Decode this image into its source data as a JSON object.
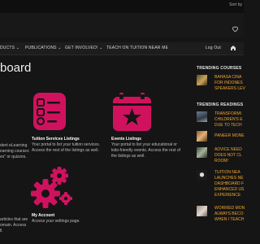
{
  "topbar": {
    "sort_label": "Sort by"
  },
  "nav": {
    "items": [
      "DUCTS ⌄",
      "PUBLICATIONS ⌄",
      "GET INVOLVED! ⌄",
      "TEACH ON TUITION NEAR ME"
    ],
    "logout": "Log Out"
  },
  "page": {
    "title": "board"
  },
  "left_partial": {
    "lines1": [
      "dent eLearning",
      "earning courses",
      "es\" or quizzes."
    ],
    "lines2": [
      "articles that are",
      "omain. Access",
      "ll."
    ]
  },
  "cards": [
    {
      "title": "Tuition Services Listings",
      "desc": [
        "Your portal to list your tuition services.",
        "Access the rest of the listings as well."
      ],
      "icon": "list-checklist-icon"
    },
    {
      "title": "Events Listings",
      "desc": [
        "Your portal to list your educational or",
        "kids-friendly events. Access the rest of",
        "the listings as well."
      ],
      "icon": "calendar-star-icon"
    },
    {
      "title": "My Account",
      "desc": [
        "Access your settings page."
      ],
      "icon": "gears-icon"
    }
  ],
  "sidebar": {
    "trending_courses_heading": "TRENDING COURSES",
    "courses": [
      {
        "lines": [
          "BAHASA CINA",
          "FOR INDONES",
          "SPEAKERS LEV"
        ]
      }
    ],
    "trending_readings_heading": "TRENDING READINGS",
    "readings": [
      {
        "lines": [
          "TRANSFORMI",
          "CHILDREN'S E",
          "DUE TO TECH"
        ]
      },
      {
        "lines": [
          "PANEER MONE"
        ]
      },
      {
        "lines": [
          "ADVICE NEED",
          "DOES NOT CL",
          "ROOM!"
        ]
      },
      {
        "lines": [
          "TUITION NEA",
          "LAUNCHES NE",
          "DASHBOARD F",
          "ENHANCED US",
          "EXPERIENCE"
        ]
      },
      {
        "lines": [
          "WORRIED MON",
          "ALWAYS BECO",
          "WHEN I TEACH"
        ]
      }
    ]
  },
  "colors": {
    "accent": "#d0125e",
    "link": "#f0a431",
    "background": "#151515"
  }
}
